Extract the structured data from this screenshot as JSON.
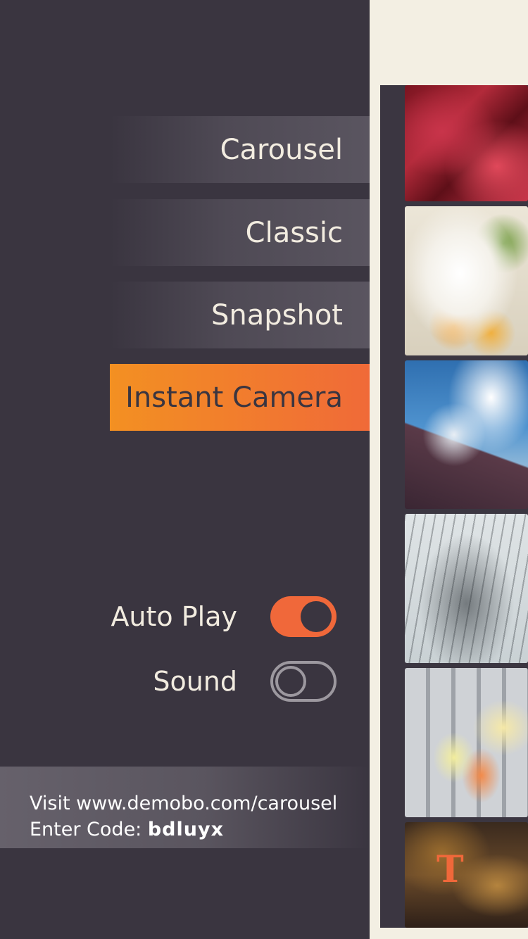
{
  "menu": {
    "items": [
      {
        "label": "Carousel",
        "active": false
      },
      {
        "label": "Classic",
        "active": false
      },
      {
        "label": "Snapshot",
        "active": false
      },
      {
        "label": "Instant Camera",
        "active": true
      }
    ]
  },
  "settings": {
    "auto_play": {
      "label": "Auto Play",
      "on": true
    },
    "sound": {
      "label": "Sound",
      "on": false
    }
  },
  "info": {
    "visit_text": "Visit www.demobo.com/carousel",
    "code_label": "Enter Code: ",
    "code_value": "bdluyx"
  },
  "gallery": {
    "photos": [
      "red-flower-photo",
      "ice-cream-photo",
      "city-sky-photo",
      "bare-tree-photo",
      "gummy-bears-keyboard-photo",
      "food-photo"
    ],
    "brand_letter": "T"
  },
  "colors": {
    "accent": "#f0683a",
    "accent_start": "#f39022",
    "sidebar_bg": "#3a3540",
    "panel_bg": "#f3efe3",
    "text_light": "#f2ece0"
  }
}
